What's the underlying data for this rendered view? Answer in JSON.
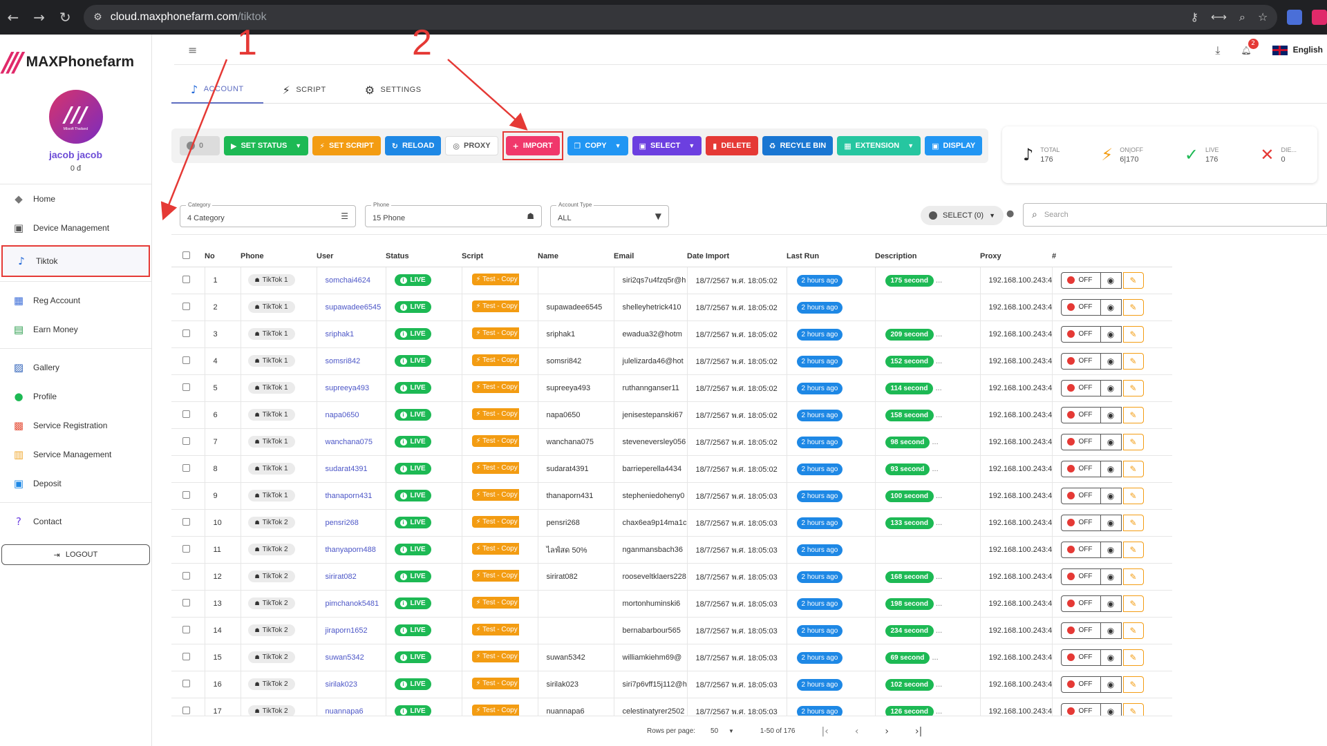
{
  "browser": {
    "url_host": "cloud.maxphonefarm.com",
    "url_path": "/tiktok"
  },
  "sidebar": {
    "logo_text": "MAXPhonefarm",
    "avatar_caption": "Mbsoft Thailand",
    "user_name": "jacob jacob",
    "balance": "0 đ",
    "items": [
      {
        "label": "Home",
        "icon": "home-icon"
      },
      {
        "label": "Device Management",
        "icon": "device-icon"
      },
      {
        "label": "Tiktok",
        "icon": "tiktok-icon"
      },
      {
        "label": "Reg Account",
        "icon": "reg-account-icon"
      },
      {
        "label": "Earn Money",
        "icon": "earn-money-icon"
      },
      {
        "label": "Gallery",
        "icon": "gallery-icon"
      },
      {
        "label": "Profile",
        "icon": "profile-icon"
      },
      {
        "label": "Service Registration",
        "icon": "service-registration-icon"
      },
      {
        "label": "Service Management",
        "icon": "service-management-icon"
      },
      {
        "label": "Deposit",
        "icon": "deposit-icon"
      },
      {
        "label": "Contact",
        "icon": "contact-icon"
      }
    ],
    "logout": "LOGOUT"
  },
  "header": {
    "notif_count": "2",
    "language": "English"
  },
  "tabs": [
    {
      "label": "ACCOUNT",
      "active": true
    },
    {
      "label": "SCRIPT"
    },
    {
      "label": "SETTINGS"
    }
  ],
  "toolbar": {
    "toggle_count": "0",
    "set_status": "SET STATUS",
    "set_script": "SET SCRIPT",
    "reload": "RELOAD",
    "proxy": "PROXY",
    "import": "IMPORT",
    "copy": "COPY",
    "select": "SELECT",
    "delete": "DELETE",
    "recycle_bin": "RECYLE BIN",
    "extension": "EXTENSION",
    "display": "DISPLAY"
  },
  "stats": [
    {
      "label": "TOTAL",
      "value": "176",
      "color": "#222222"
    },
    {
      "label": "ON|OFF",
      "value": "6|170",
      "color": "#f39c12"
    },
    {
      "label": "LIVE",
      "value": "176",
      "color": "#1db954"
    },
    {
      "label": "DIE...",
      "value": "0",
      "color": "#e53935"
    }
  ],
  "filters": {
    "category_label": "Category",
    "category_value": "4 Category",
    "phone_label": "Phone",
    "phone_value": "15 Phone",
    "account_type_label": "Account Type",
    "account_type_value": "ALL",
    "select_pill": "SELECT (0)",
    "search_placeholder": "Search"
  },
  "table": {
    "columns": [
      "No",
      "Phone",
      "User",
      "Status",
      "Script",
      "Name",
      "Email",
      "Date Import",
      "Last Run",
      "Description",
      "Proxy",
      "#"
    ],
    "rows": [
      {
        "no": "1",
        "phone": "TikTok 1",
        "user": "somchai4624",
        "status": "LIVE",
        "script": "Test - Copy",
        "name": "",
        "email": "siri2qs7u4fzq5r@h",
        "date": "18/7/2567 พ.ศ. 18:05:02",
        "lastrun": "2 hours ago",
        "desc": "175 second",
        "desc_extra": "...",
        "proxy": "192.168.100.243:4",
        "action": "OFF"
      },
      {
        "no": "2",
        "phone": "TikTok 1",
        "user": "supawadee6545",
        "status": "LIVE",
        "script": "Test - Copy",
        "name": "supawadee6545",
        "email": "shelleyhetrick410",
        "date": "18/7/2567 พ.ศ. 18:05:02",
        "lastrun": "2 hours ago",
        "desc": "",
        "desc_extra": "",
        "proxy": "192.168.100.243:4",
        "action": "OFF"
      },
      {
        "no": "3",
        "phone": "TikTok 1",
        "user": "sriphak1",
        "status": "LIVE",
        "script": "Test - Copy",
        "name": "sriphak1",
        "email": "ewadua32@hotm",
        "date": "18/7/2567 พ.ศ. 18:05:02",
        "lastrun": "2 hours ago",
        "desc": "209 second",
        "desc_extra": "...",
        "proxy": "192.168.100.243:4",
        "action": "OFF"
      },
      {
        "no": "4",
        "phone": "TikTok 1",
        "user": "somsri842",
        "status": "LIVE",
        "script": "Test - Copy",
        "name": "somsri842",
        "email": "julelizarda46@hot",
        "date": "18/7/2567 พ.ศ. 18:05:02",
        "lastrun": "2 hours ago",
        "desc": "152 second",
        "desc_extra": "...",
        "proxy": "192.168.100.243:4",
        "action": "OFF"
      },
      {
        "no": "5",
        "phone": "TikTok 1",
        "user": "supreeya493",
        "status": "LIVE",
        "script": "Test - Copy",
        "name": "supreeya493",
        "email": "ruthannganser11",
        "date": "18/7/2567 พ.ศ. 18:05:02",
        "lastrun": "2 hours ago",
        "desc": "114 second",
        "desc_extra": "...",
        "proxy": "192.168.100.243:4",
        "action": "OFF"
      },
      {
        "no": "6",
        "phone": "TikTok 1",
        "user": "napa0650",
        "status": "LIVE",
        "script": "Test - Copy",
        "name": "napa0650",
        "email": "jenisestepanski67",
        "date": "18/7/2567 พ.ศ. 18:05:02",
        "lastrun": "2 hours ago",
        "desc": "158 second",
        "desc_extra": "...",
        "proxy": "192.168.100.243:4",
        "action": "OFF"
      },
      {
        "no": "7",
        "phone": "TikTok 1",
        "user": "wanchana075",
        "status": "LIVE",
        "script": "Test - Copy",
        "name": "wanchana075",
        "email": "steveneversley056",
        "date": "18/7/2567 พ.ศ. 18:05:02",
        "lastrun": "2 hours ago",
        "desc": "98 second",
        "desc_extra": "...",
        "proxy": "192.168.100.243:4",
        "action": "OFF"
      },
      {
        "no": "8",
        "phone": "TikTok 1",
        "user": "sudarat4391",
        "status": "LIVE",
        "script": "Test - Copy",
        "name": "sudarat4391",
        "email": "barrieperella4434",
        "date": "18/7/2567 พ.ศ. 18:05:02",
        "lastrun": "2 hours ago",
        "desc": "93 second",
        "desc_extra": "...",
        "proxy": "192.168.100.243:4",
        "action": "OFF"
      },
      {
        "no": "9",
        "phone": "TikTok 1",
        "user": "thanaporn431",
        "status": "LIVE",
        "script": "Test - Copy",
        "name": "thanaporn431",
        "email": "stepheniedoheny0",
        "date": "18/7/2567 พ.ศ. 18:05:03",
        "lastrun": "2 hours ago",
        "desc": "100 second",
        "desc_extra": "...",
        "proxy": "192.168.100.243:4",
        "action": "OFF"
      },
      {
        "no": "10",
        "phone": "TikTok 2",
        "user": "pensri268",
        "status": "LIVE",
        "script": "Test - Copy",
        "name": "pensri268",
        "email": "chax6ea9p14ma1c",
        "date": "18/7/2567 พ.ศ. 18:05:03",
        "lastrun": "2 hours ago",
        "desc": "133 second",
        "desc_extra": "...",
        "proxy": "192.168.100.243:4",
        "action": "OFF"
      },
      {
        "no": "11",
        "phone": "TikTok 2",
        "user": "thanyaporn488",
        "status": "LIVE",
        "script": "Test - Copy",
        "name": "ไลฟ์สด 50%",
        "email": "nganmansbach36",
        "date": "18/7/2567 พ.ศ. 18:05:03",
        "lastrun": "2 hours ago",
        "desc": "",
        "desc_extra": "",
        "proxy": "192.168.100.243:4",
        "action": "OFF"
      },
      {
        "no": "12",
        "phone": "TikTok 2",
        "user": "sirirat082",
        "status": "LIVE",
        "script": "Test - Copy",
        "name": "sirirat082",
        "email": "rooseveltklaers228",
        "date": "18/7/2567 พ.ศ. 18:05:03",
        "lastrun": "2 hours ago",
        "desc": "168 second",
        "desc_extra": "...",
        "proxy": "192.168.100.243:4",
        "action": "OFF"
      },
      {
        "no": "13",
        "phone": "TikTok 2",
        "user": "pimchanok5481",
        "status": "LIVE",
        "script": "Test - Copy",
        "name": "",
        "email": "mortonhuminski6",
        "date": "18/7/2567 พ.ศ. 18:05:03",
        "lastrun": "2 hours ago",
        "desc": "198 second",
        "desc_extra": "...",
        "proxy": "192.168.100.243:4",
        "action": "OFF"
      },
      {
        "no": "14",
        "phone": "TikTok 2",
        "user": "jiraporn1652",
        "status": "LIVE",
        "script": "Test - Copy",
        "name": "",
        "email": "bernabarbour565",
        "date": "18/7/2567 พ.ศ. 18:05:03",
        "lastrun": "2 hours ago",
        "desc": "234 second",
        "desc_extra": "...",
        "proxy": "192.168.100.243:4",
        "action": "OFF"
      },
      {
        "no": "15",
        "phone": "TikTok 2",
        "user": "suwan5342",
        "status": "LIVE",
        "script": "Test - Copy",
        "name": "suwan5342",
        "email": "williamkiehm69@",
        "date": "18/7/2567 พ.ศ. 18:05:03",
        "lastrun": "2 hours ago",
        "desc": "69 second",
        "desc_extra": "...",
        "proxy": "192.168.100.243:4",
        "action": "OFF"
      },
      {
        "no": "16",
        "phone": "TikTok 2",
        "user": "sirilak023",
        "status": "LIVE",
        "script": "Test - Copy",
        "name": "sirilak023",
        "email": "siri7p6vff15j112@h",
        "date": "18/7/2567 พ.ศ. 18:05:03",
        "lastrun": "2 hours ago",
        "desc": "102 second",
        "desc_extra": "...",
        "proxy": "192.168.100.243:4",
        "action": "OFF"
      },
      {
        "no": "17",
        "phone": "TikTok 2",
        "user": "nuannapa6",
        "status": "LIVE",
        "script": "Test - Copy",
        "name": "nuannapa6",
        "email": "celestinatyrer2502",
        "date": "18/7/2567 พ.ศ. 18:05:03",
        "lastrun": "2 hours ago",
        "desc": "126 second",
        "desc_extra": "...",
        "proxy": "192.168.100.243:4",
        "action": "OFF"
      }
    ]
  },
  "pager": {
    "rows_per_page_label": "Rows per page:",
    "rows_per_page": "50",
    "range": "1-50 of 176"
  },
  "annotations": {
    "marker_1": "1",
    "marker_2": "2",
    "color": "#e53935"
  }
}
